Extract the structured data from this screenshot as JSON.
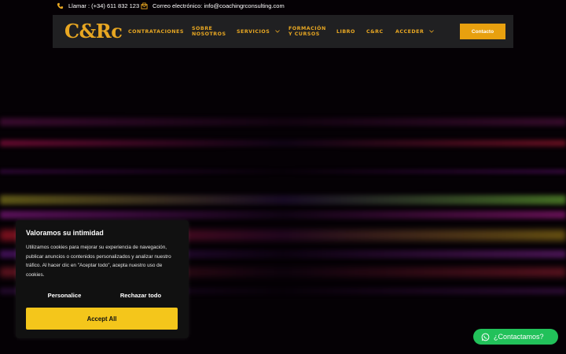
{
  "topbar": {
    "phone_text": "Llamar : (+34) 611 832 123",
    "email_text": "Correo electrónico: info@coachingrconsulting.com",
    "accent_color": "#e8a722"
  },
  "nav": {
    "logo": "C&Rc",
    "items": [
      {
        "label_line1": "CONTRATACIONES",
        "label_line2": ""
      },
      {
        "label_line1": "SOBRE",
        "label_line2": "NOSOTROS"
      },
      {
        "label_line1": "SERVICIOS",
        "label_line2": ""
      },
      {
        "label_line1": "FORMACIÓN",
        "label_line2": "Y CURSOS"
      },
      {
        "label_line1": "LIBRO",
        "label_line2": ""
      },
      {
        "label_line1": "C&RC",
        "label_line2": ""
      },
      {
        "label_line1": "ACCEDER",
        "label_line2": ""
      }
    ],
    "contact_button": "Contacto"
  },
  "cookie_banner": {
    "title": "Valoramos su intimidad",
    "body": "Utilizamos cookies para mejorar su experiencia de navegación, publicar anuncios o contenidos personalizados y analizar nuestro tráfico. Al hacer clic en \"Aceptar todo\", acepta nuestro uso de cookies.",
    "personalize_label": "Personalice",
    "reject_label": "Rechazar todo",
    "accept_label": "Accept All",
    "accept_color": "#f4c61b"
  },
  "whatsapp": {
    "label": "¿Contactamos?",
    "color": "#22c15a"
  }
}
